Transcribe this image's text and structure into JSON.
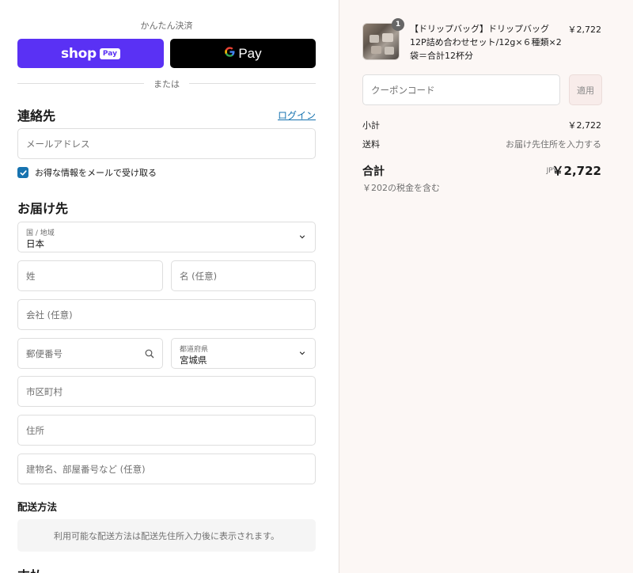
{
  "express": {
    "label": "かんたん決済",
    "shop_word": "shop",
    "shop_pill": "Pay",
    "gpay_g": "G",
    "gpay_word": "Pay",
    "divider": "または"
  },
  "contact": {
    "heading": "連絡先",
    "login_link": "ログイン",
    "email_placeholder": "メールアドレス",
    "newsletter_label": "お得な情報をメールで受け取る",
    "newsletter_checked": true
  },
  "delivery": {
    "heading": "お届け先",
    "country_label": "国 / 地域",
    "country_value": "日本",
    "last_name_placeholder": "姓",
    "first_name_placeholder": "名 (任意)",
    "company_placeholder": "会社 (任意)",
    "postal_placeholder": "郵便番号",
    "prefecture_label": "都道府県",
    "prefecture_value": "宮城県",
    "city_placeholder": "市区町村",
    "address_placeholder": "住所",
    "building_placeholder": "建物名、部屋番号など (任意)"
  },
  "shipping": {
    "heading": "配送方法",
    "notice": "利用可能な配送方法は配送先住所入力後に表示されます。"
  },
  "next_heading": "支払",
  "summary": {
    "product": {
      "title": "【ドリップバッグ】ドリップバッグ12P詰め合わせセット/12g×６種類×2袋＝合計12杯分",
      "price": "￥2,722",
      "quantity": "1"
    },
    "coupon_placeholder": "クーポンコード",
    "apply_label": "適用",
    "subtotal_label": "小計",
    "subtotal_value": "￥2,722",
    "shipping_label": "送料",
    "shipping_value": "お届け先住所を入力する",
    "total_label": "合計",
    "total_currency": "JPY",
    "total_value": "￥2,722",
    "tax_note": "￥202の税金を含む"
  },
  "colors": {
    "shop_pay": "#5a31f4",
    "link": "#1773b0",
    "summary_bg": "#fcf7f5"
  }
}
